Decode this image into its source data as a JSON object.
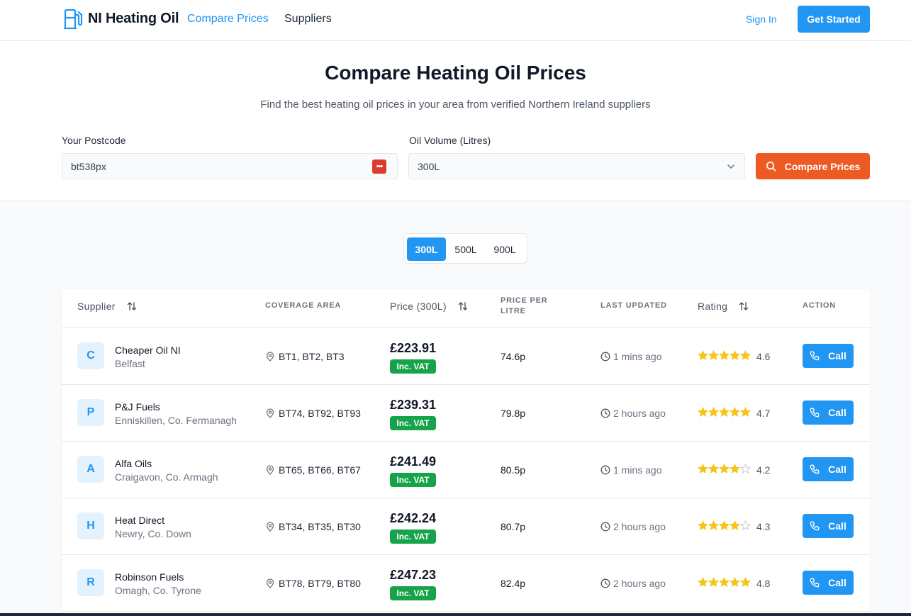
{
  "nav": {
    "brand": "NI Heating Oil",
    "links": [
      "Compare Prices",
      "Suppliers"
    ],
    "sign_in": "Sign In",
    "get_started": "Get Started",
    "brand_color": "#2196f3"
  },
  "hero": {
    "title": "Compare Heating Oil Prices",
    "subtitle": "Find the best heating oil prices in your area from verified Northern Ireland suppliers",
    "postcode_label": "Your Postcode",
    "postcode_value": "bt538px",
    "volume_label": "Oil Volume (Litres)",
    "volume_value": "300L",
    "compare_button": "Compare Prices",
    "compare_color": "#ee5a24"
  },
  "volume_toggle": {
    "options": [
      "300L",
      "500L",
      "900L"
    ],
    "selected": "300L"
  },
  "table": {
    "headers": {
      "supplier": "Supplier",
      "coverage": "COVERAGE AREA",
      "price": "Price (300L)",
      "ppl": "PRICE PER LITRE",
      "updated": "LAST UPDATED",
      "rating": "Rating",
      "action": "ACTION"
    },
    "vat_label": "Inc. VAT",
    "call_label": "Call",
    "rows": [
      {
        "initial": "C",
        "name": "Cheaper Oil NI",
        "location": "Belfast",
        "coverage": "BT1, BT2, BT3",
        "price": "£223.91",
        "ppl": "74.6p",
        "updated": "1 mins ago",
        "rating": "4.6",
        "stars": 4.6
      },
      {
        "initial": "P",
        "name": "P&J Fuels",
        "location": "Enniskillen, Co. Fermanagh",
        "coverage": "BT74, BT92, BT93",
        "price": "£239.31",
        "ppl": "79.8p",
        "updated": "2 hours ago",
        "rating": "4.7",
        "stars": 4.7
      },
      {
        "initial": "A",
        "name": "Alfa Oils",
        "location": "Craigavon, Co. Armagh",
        "coverage": "BT65, BT66, BT67",
        "price": "£241.49",
        "ppl": "80.5p",
        "updated": "1 mins ago",
        "rating": "4.2",
        "stars": 4.2
      },
      {
        "initial": "H",
        "name": "Heat Direct",
        "location": "Newry, Co. Down",
        "coverage": "BT34, BT35, BT30",
        "price": "£242.24",
        "ppl": "80.7p",
        "updated": "2 hours ago",
        "rating": "4.3",
        "stars": 4.3
      },
      {
        "initial": "R",
        "name": "Robinson Fuels",
        "location": "Omagh, Co. Tyrone",
        "coverage": "BT78, BT79, BT80",
        "price": "£247.23",
        "ppl": "82.4p",
        "updated": "2 hours ago",
        "rating": "4.8",
        "stars": 4.8
      }
    ]
  }
}
